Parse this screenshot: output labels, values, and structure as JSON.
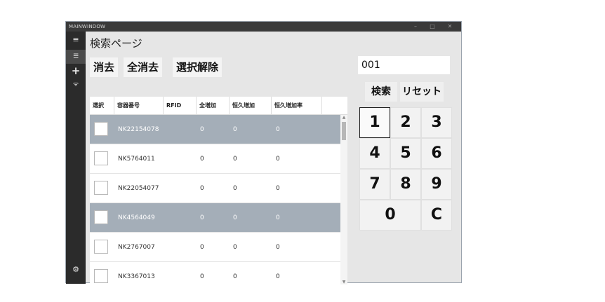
{
  "window": {
    "title": "MAINWINDOW",
    "minimize": "–",
    "maximize": "□",
    "close": "✕"
  },
  "sidebar": [
    {
      "icon": "hamburger-menu-icon",
      "glyph": "≡"
    },
    {
      "icon": "list-icon",
      "glyph": "☰"
    },
    {
      "icon": "plus-icon",
      "glyph": "+"
    },
    {
      "icon": "wifi-icon",
      "glyph": "ᯤ"
    },
    {
      "icon": "gear-icon",
      "glyph": "⚙"
    }
  ],
  "page": {
    "title": "検索ページ"
  },
  "toolbar": {
    "delete_label": "消去",
    "delete_all_label": "全消去",
    "deselect_label": "選択解除"
  },
  "table": {
    "headers": [
      "選択",
      "容器番号",
      "RFID",
      "全増加",
      "恒久増加",
      "恒久増加率"
    ],
    "rows": [
      {
        "id": "NK22154078",
        "rfid": "",
        "total": "0",
        "perm": "0",
        "rate": "0",
        "selected": true
      },
      {
        "id": "NK5764011",
        "rfid": "",
        "total": "0",
        "perm": "0",
        "rate": "0",
        "selected": false
      },
      {
        "id": "NK22054077",
        "rfid": "",
        "total": "0",
        "perm": "0",
        "rate": "0",
        "selected": false
      },
      {
        "id": "NK4564049",
        "rfid": "",
        "total": "0",
        "perm": "0",
        "rate": "0",
        "selected": true
      },
      {
        "id": "NK2767007",
        "rfid": "",
        "total": "0",
        "perm": "0",
        "rate": "0",
        "selected": false
      },
      {
        "id": "NK3367013",
        "rfid": "",
        "total": "0",
        "perm": "0",
        "rate": "0",
        "selected": false
      }
    ]
  },
  "search": {
    "value": "001",
    "search_label": "検索",
    "reset_label": "リセット"
  },
  "keypad": {
    "keys": [
      "1",
      "2",
      "3",
      "4",
      "5",
      "6",
      "7",
      "8",
      "9",
      "0",
      "C"
    ]
  },
  "colors": {
    "selected_row": "#a4aeb8",
    "sidebar": "#2b2b2b",
    "titlebar": "#3a3a3a"
  }
}
